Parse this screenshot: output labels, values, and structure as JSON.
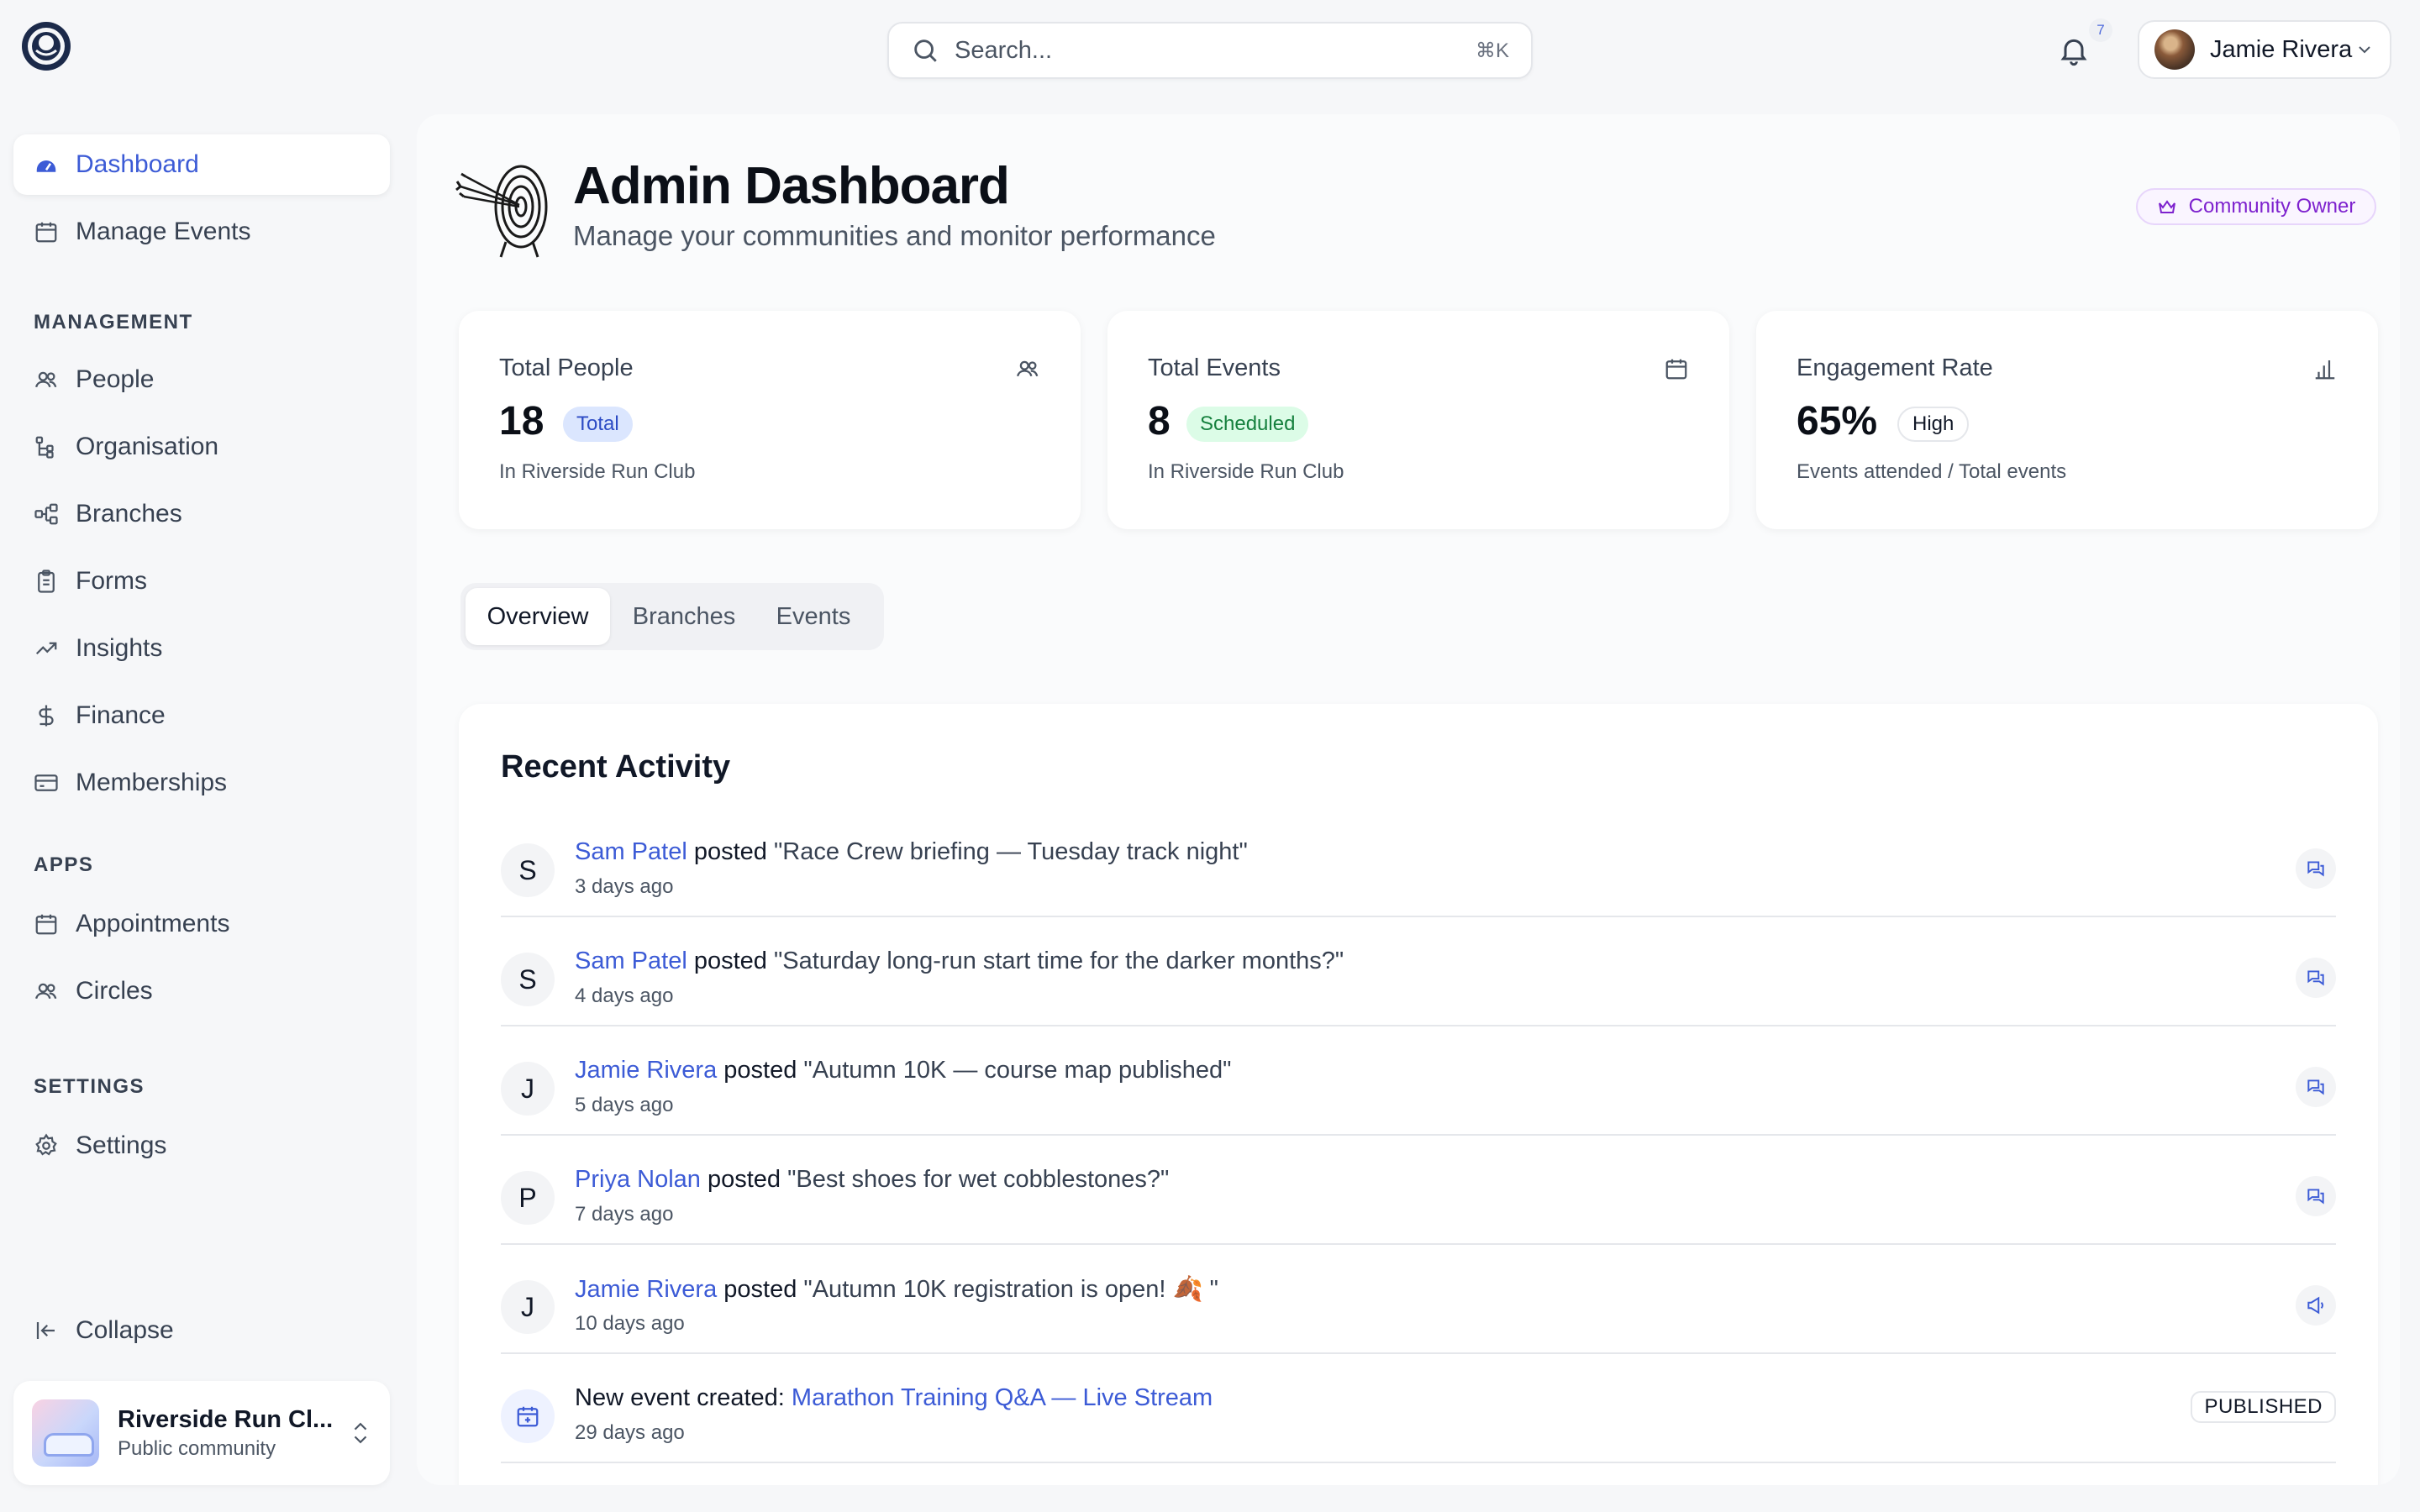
{
  "app": {
    "search_placeholder": "Search...",
    "search_shortcut": "⌘K",
    "notification_count": "7",
    "user_name": "Jamie Rivera"
  },
  "sidebar": {
    "primary": [
      {
        "label": "Dashboard",
        "icon": "dashboard-icon",
        "active": true
      },
      {
        "label": "Manage Events",
        "icon": "calendar-icon"
      }
    ],
    "sections": {
      "management": "MANAGEMENT",
      "apps": "APPS",
      "settings": "SETTINGS"
    },
    "management": [
      {
        "label": "People",
        "icon": "people-icon"
      },
      {
        "label": "Organisation",
        "icon": "org-tree-icon"
      },
      {
        "label": "Branches",
        "icon": "branches-icon"
      },
      {
        "label": "Forms",
        "icon": "clipboard-icon"
      },
      {
        "label": "Insights",
        "icon": "trend-up-icon"
      },
      {
        "label": "Finance",
        "icon": "dollar-icon"
      },
      {
        "label": "Memberships",
        "icon": "card-icon"
      }
    ],
    "apps": [
      {
        "label": "Appointments",
        "icon": "calendar-icon"
      },
      {
        "label": "Circles",
        "icon": "people-icon"
      }
    ],
    "settings": [
      {
        "label": "Settings",
        "icon": "gear-icon"
      }
    ],
    "collapse": "Collapse",
    "community": {
      "name": "Riverside Run Club",
      "name_display": "Riverside Run Cl...",
      "type": "Public community"
    }
  },
  "header": {
    "title": "Admin Dashboard",
    "subtitle": "Manage your communities and monitor performance",
    "role_badge": "Community Owner"
  },
  "stats": [
    {
      "label": "Total People",
      "value": "18",
      "pill": "Total",
      "note": "In Riverside Run Club",
      "icon": "people-icon"
    },
    {
      "label": "Total Events",
      "value": "8",
      "pill": "Scheduled",
      "note": "In Riverside Run Club",
      "icon": "calendar-icon"
    },
    {
      "label": "Engagement Rate",
      "value": "65%",
      "pill": "High",
      "note": "Events attended / Total events",
      "icon": "bar-chart-icon"
    }
  ],
  "tabs": [
    {
      "label": "Overview",
      "active": true
    },
    {
      "label": "Branches"
    },
    {
      "label": "Events"
    }
  ],
  "activity": {
    "title": "Recent Activity",
    "items": [
      {
        "initial": "S",
        "who": "Sam Patel",
        "verb": "posted",
        "text": "\"Race Crew briefing — Tuesday track night\"",
        "time": "3 days ago",
        "icon": "chat-icon"
      },
      {
        "initial": "S",
        "who": "Sam Patel",
        "verb": "posted",
        "text": "\"Saturday long-run start time for the darker months?\"",
        "time": "4 days ago",
        "icon": "chat-icon"
      },
      {
        "initial": "J",
        "who": "Jamie Rivera",
        "verb": "posted",
        "text": "\"Autumn 10K — course map published\"",
        "time": "5 days ago",
        "icon": "chat-icon"
      },
      {
        "initial": "P",
        "who": "Priya Nolan",
        "verb": "posted",
        "text": "\"Best shoes for wet cobblestones?\"",
        "time": "7 days ago",
        "icon": "chat-icon"
      },
      {
        "initial": "J",
        "who": "Jamie Rivera",
        "verb": "posted",
        "text": "\"Autumn 10K registration is open! 🍂 \"",
        "time": "10 days ago",
        "icon": "megaphone-icon"
      },
      {
        "prefix": "New event created:",
        "event": "Marathon Training Q&A — Live Stream",
        "time": "29 days ago",
        "status": "PUBLISHED",
        "icon": "calendar-plus-icon"
      }
    ]
  },
  "colors": {
    "accent": "#3c5bd6",
    "owner_purple": "#7e22ce",
    "total_pill_bg": "#dbe6fe",
    "scheduled_pill_bg": "#dcfce7",
    "scheduled_text": "#15803d"
  }
}
